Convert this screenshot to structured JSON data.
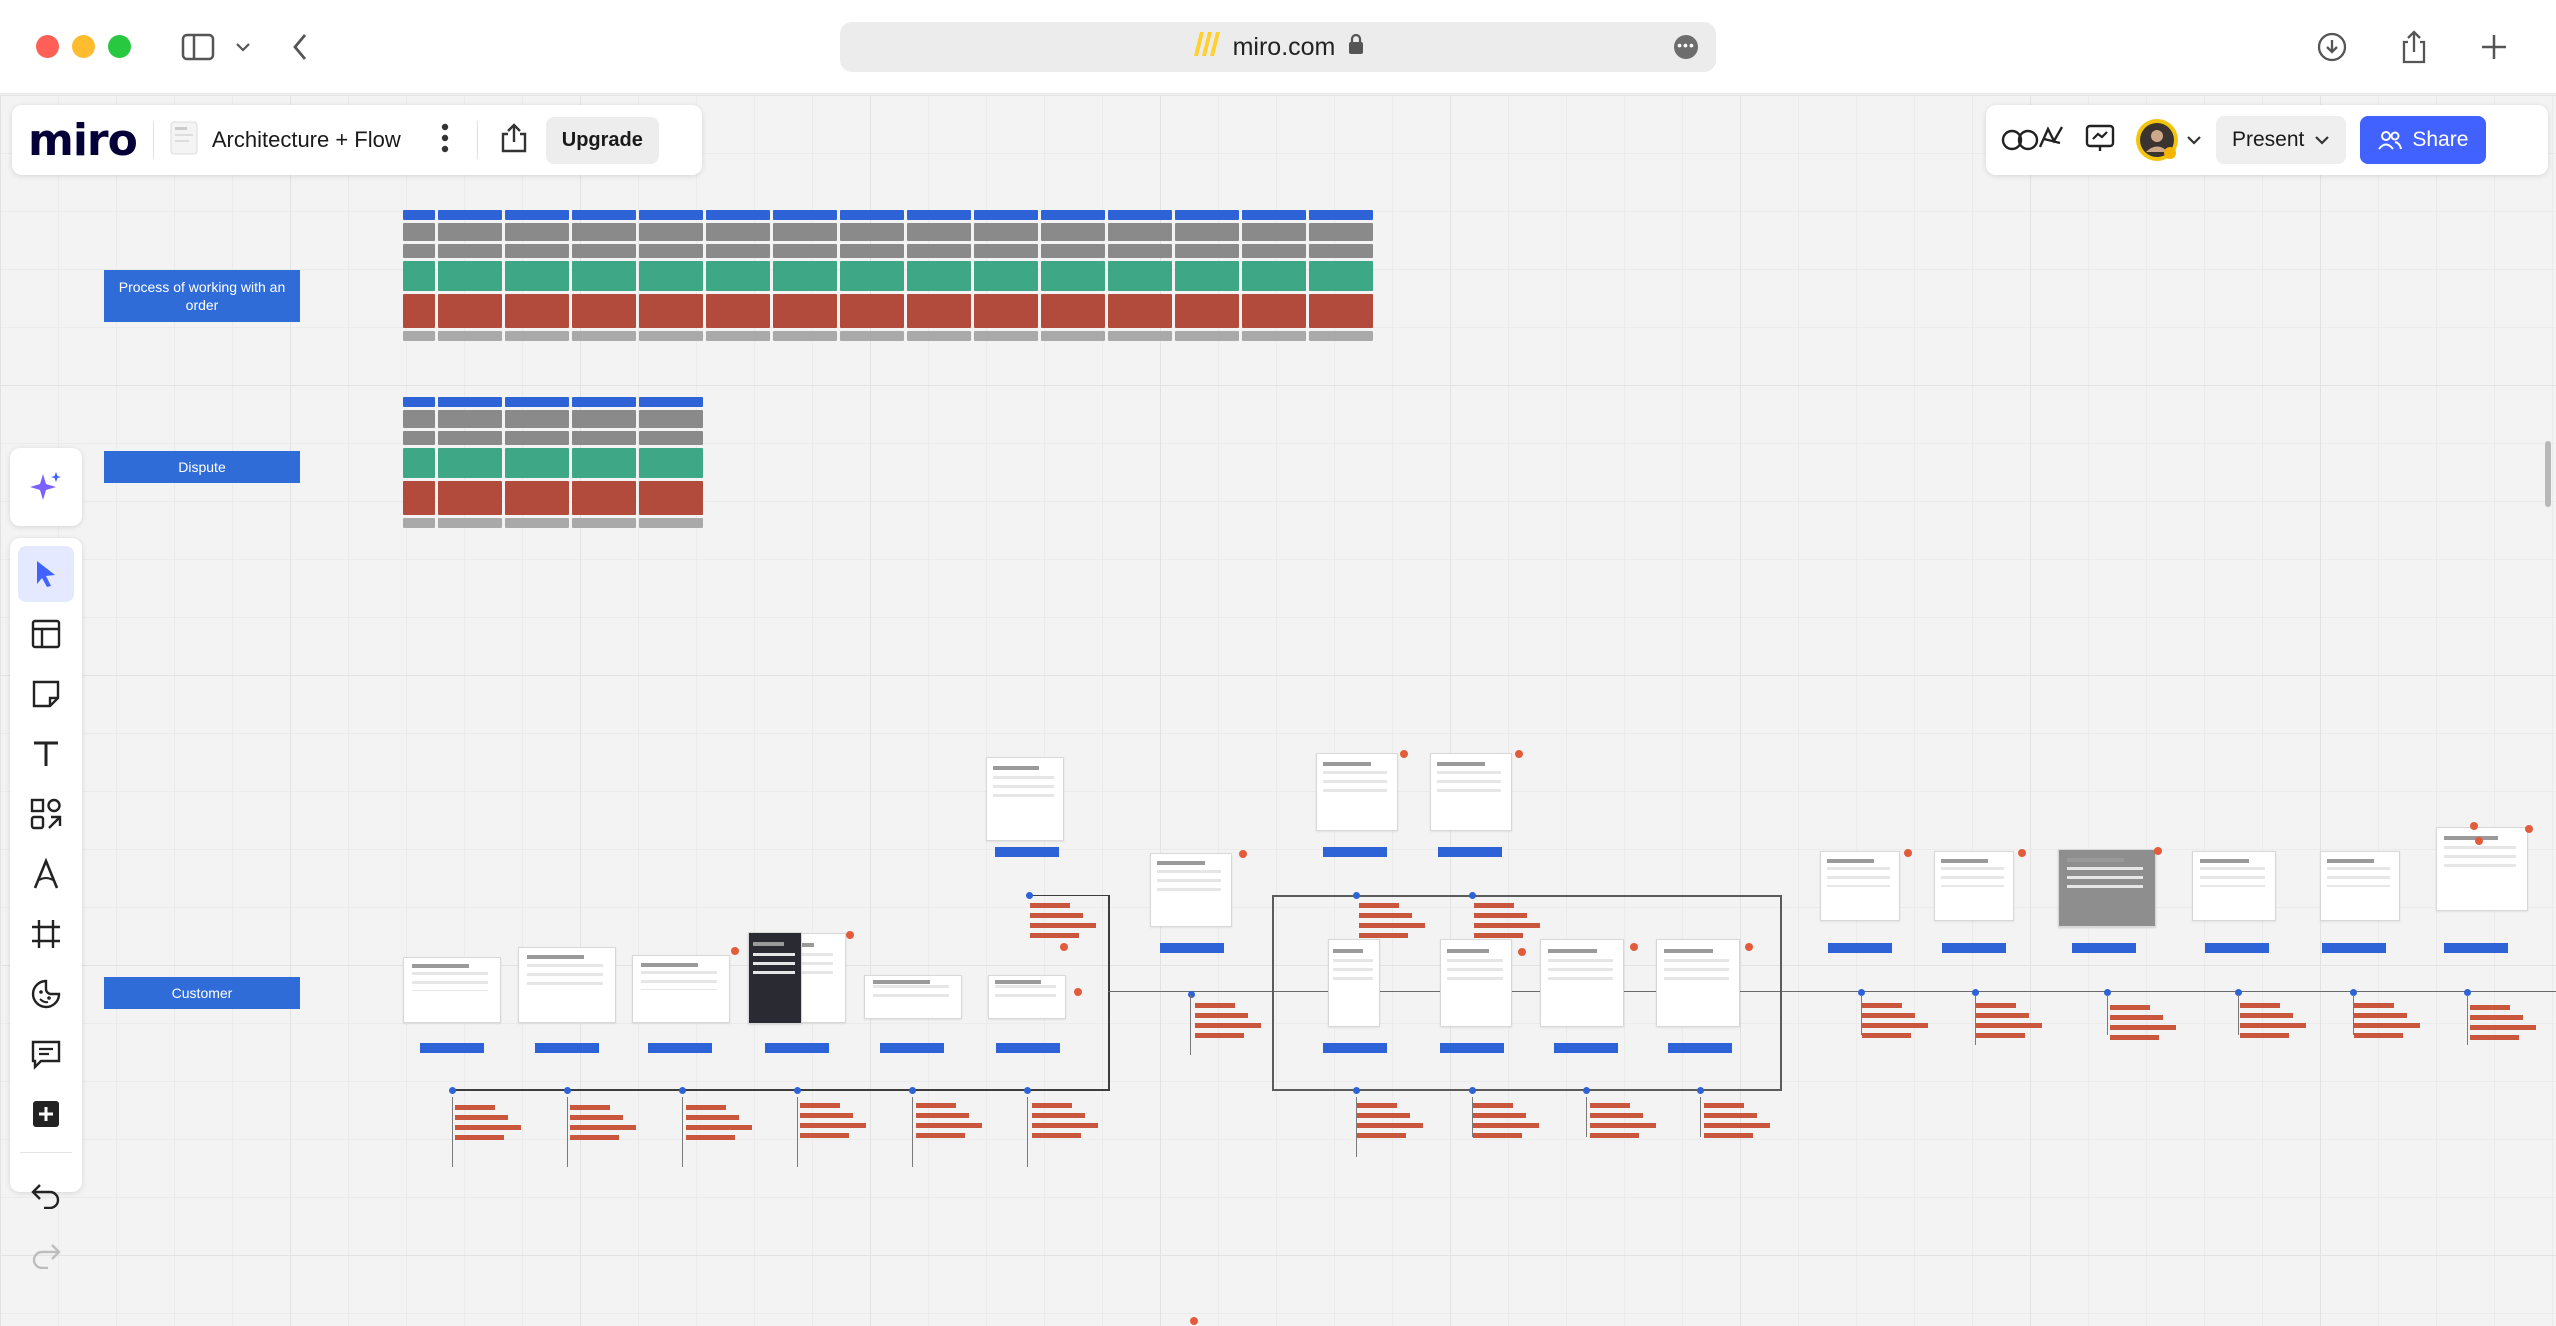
{
  "browser": {
    "url": "miro.com"
  },
  "board": {
    "logo": "miro",
    "title": "Architecture + Flow",
    "upgrade_label": "Upgrade",
    "present_label": "Present",
    "share_label": "Share"
  },
  "toolbar": {
    "tools": [
      "ai-assist",
      "select",
      "templates",
      "sticky-note",
      "text",
      "shapes",
      "pen",
      "frame",
      "stickers",
      "comment",
      "more",
      "undo",
      "redo"
    ]
  },
  "sections": [
    {
      "label": "Process of working with an order"
    },
    {
      "label": "Dispute"
    },
    {
      "label": "Customer"
    }
  ],
  "colors": {
    "accent": "#4262ff",
    "section_blue": "#2f6cd8",
    "row_green": "#3ea886",
    "row_red": "#b24b3c",
    "row_gray": "#8a8a8a"
  }
}
